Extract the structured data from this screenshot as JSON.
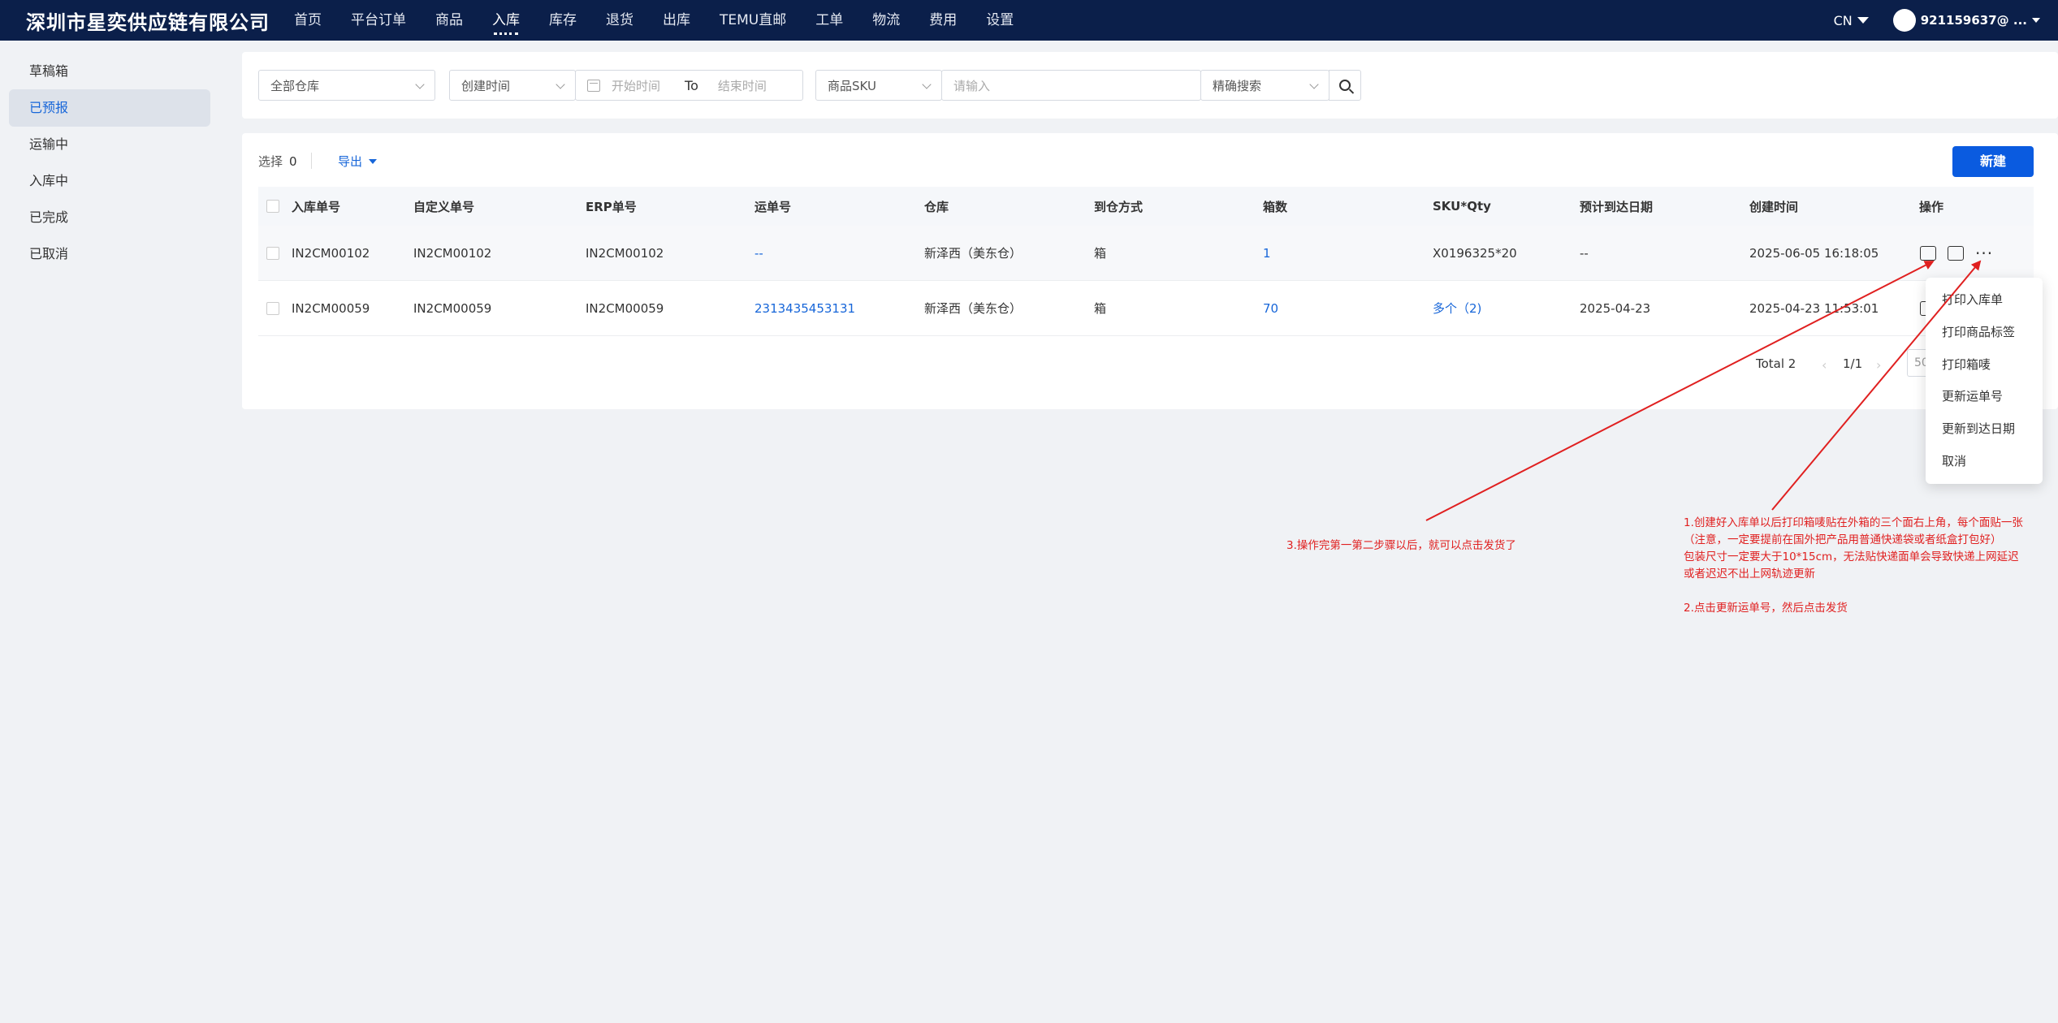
{
  "topbar": {
    "brand": "深圳市星奕供应链有限公司",
    "nav": [
      "首页",
      "平台订单",
      "商品",
      "入库",
      "库存",
      "退货",
      "出库",
      "TEMU直邮",
      "工单",
      "物流",
      "费用",
      "设置"
    ],
    "active_nav": "入库",
    "lang": "CN",
    "user": "921159637@ ..."
  },
  "sidebar": {
    "items": [
      "草稿箱",
      "已预报",
      "运输中",
      "入库中",
      "已完成",
      "已取消"
    ],
    "active": "已预报"
  },
  "filters": {
    "warehouse": "全部仓库",
    "time_type": "创建时间",
    "start_placeholder": "开始时间",
    "to_label": "To",
    "end_placeholder": "结束时间",
    "search_type": "商品SKU",
    "search_placeholder": "请输入",
    "match_mode": "精确搜索"
  },
  "toolbar": {
    "select_label": "选择",
    "select_count": "0",
    "export_label": "导出",
    "new_label": "新建"
  },
  "table": {
    "headers": [
      "入库单号",
      "自定义单号",
      "ERP单号",
      "运单号",
      "仓库",
      "到仓方式",
      "箱数",
      "SKU*Qty",
      "预计到达日期",
      "创建时间",
      "操作"
    ],
    "rows": [
      [
        "IN2CM00102",
        "IN2CM00102",
        "IN2CM00102",
        "--",
        "新泽西（美东仓）",
        "箱",
        "1",
        "X0196325*20",
        "--",
        "2025-06-05 16:18:05"
      ],
      [
        "IN2CM00059",
        "IN2CM00059",
        "IN2CM00059",
        "2313435453131",
        "新泽西（美东仓）",
        "箱",
        "70",
        "多个（2)",
        "2025-04-23",
        "2025-04-23 11:53:01"
      ]
    ]
  },
  "pagination": {
    "total": "Total 2",
    "page": "1/1",
    "size": "50"
  },
  "dropdown": {
    "items": [
      "打印入库单",
      "打印商品标签",
      "打印箱唛",
      "更新运单号",
      "更新到达日期",
      "取消"
    ]
  },
  "annotations": {
    "note3": "3.操作完第一第二步骤以后，就可以点击发货了",
    "note1_lines": [
      "1.创建好入库单以后打印箱唛贴在外箱的三个面右上角，每个面贴一张",
      "（注意，一定要提前在国外把产品用普通快递袋或者纸盒打包好）",
      "包装尺寸一定要大于10*15cm，无法贴快递面单会导致快递上网延迟",
      "或者迟迟不出上网轨迹更新"
    ],
    "note2": "2.点击更新运单号，然后点击发货",
    "color": "#e02020"
  },
  "colors": {
    "topbar": "#0b1f4a",
    "primary": "#0a5be0",
    "link": "#1766d9"
  }
}
